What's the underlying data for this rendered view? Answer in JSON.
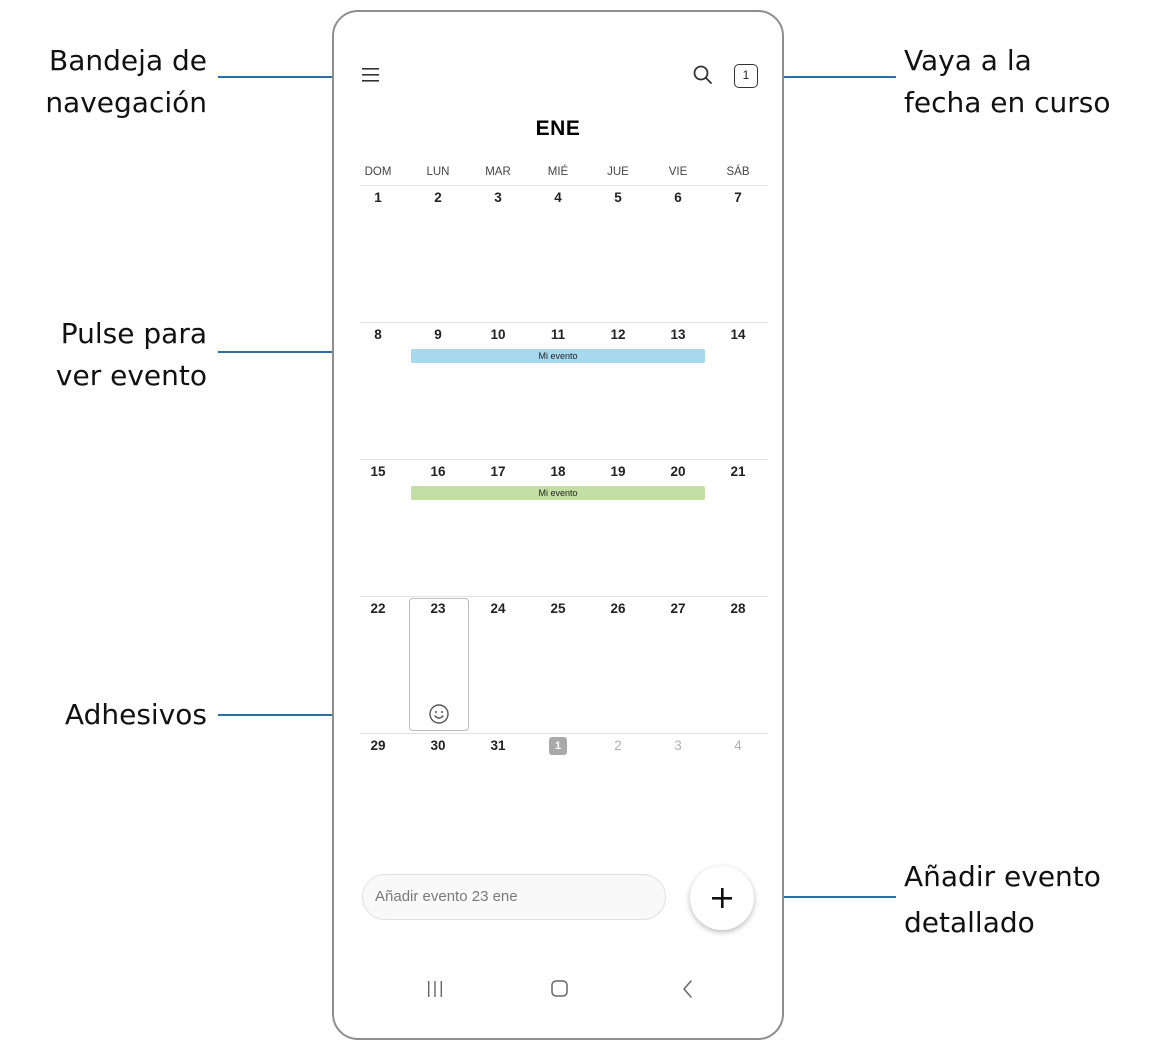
{
  "callouts": {
    "nav_drawer": [
      "Bandeja de",
      "navegación"
    ],
    "today": [
      "Vaya a la",
      "fecha en curso"
    ],
    "view_event": [
      "Pulse para",
      "ver evento"
    ],
    "stickers": "Adhesivos",
    "add_detailed": [
      "Añadir evento",
      "detallado"
    ]
  },
  "header": {
    "menu_icon": "hamburger-menu-icon",
    "search_icon": "search-icon",
    "today_badge": "1",
    "month_title": "ENE"
  },
  "weekdays": [
    "DOM",
    "LUN",
    "MAR",
    "MIÉ",
    "JUE",
    "VIE",
    "SÁB"
  ],
  "weeks": [
    [
      "1",
      "2",
      "3",
      "4",
      "5",
      "6",
      "7"
    ],
    [
      "8",
      "9",
      "10",
      "11",
      "12",
      "13",
      "14"
    ],
    [
      "15",
      "16",
      "17",
      "18",
      "19",
      "20",
      "21"
    ],
    [
      "22",
      "23",
      "24",
      "25",
      "26",
      "27",
      "28"
    ],
    [
      "29",
      "30",
      "31",
      "1",
      "2",
      "3",
      "4"
    ]
  ],
  "events": [
    {
      "label": "Mi evento",
      "color": "#a6d9ee"
    },
    {
      "label": "Mi evento",
      "color": "#c4dfa3"
    }
  ],
  "sticker_icon": "smiley-icon",
  "quick_add": {
    "placeholder": "Añadir evento 23 ene",
    "fab_icon": "plus-icon"
  },
  "nav_bar": {
    "recents_icon": "recents-icon",
    "home_icon": "home-icon",
    "back_icon": "back-icon"
  },
  "colors": {
    "callout_line": "#2d6fa0",
    "frame": "#8e8e8e"
  }
}
